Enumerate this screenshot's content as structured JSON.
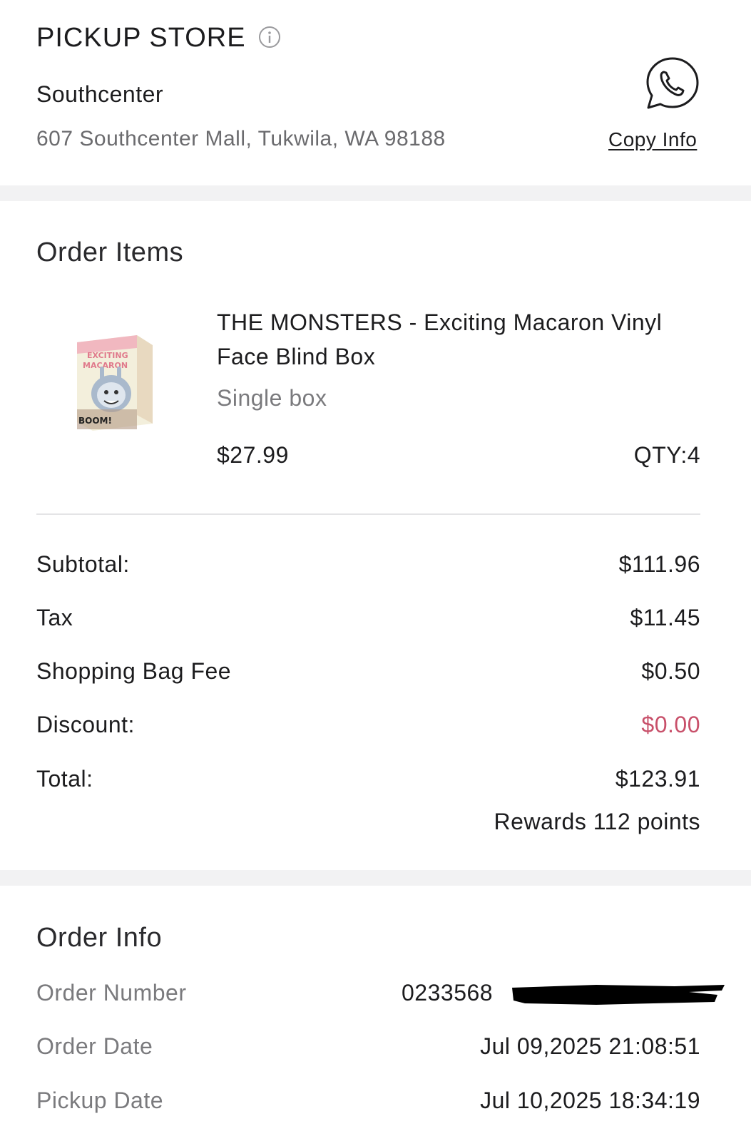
{
  "pickup_store": {
    "heading": "PICKUP STORE",
    "store_name": "Southcenter",
    "address": "607 Southcenter Mall, Tukwila, WA 98188",
    "copy_info_label": "Copy Info",
    "icons": {
      "info": "info-circle-icon",
      "contact": "whatsapp-phone-icon"
    }
  },
  "order_items": {
    "title": "Order Items",
    "items": [
      {
        "name": "THE MONSTERS - Exciting Macaron Vinyl Face Blind Box",
        "variant": "Single box",
        "price": "$27.99",
        "qty": "QTY:4",
        "thumbnail": "product-box-image",
        "thumbnail_text": [
          "EXCITING",
          "MACARON",
          "BOOM!"
        ]
      }
    ],
    "summary": {
      "subtotal_label": "Subtotal:",
      "subtotal_value": "$111.96",
      "tax_label": "Tax",
      "tax_value": "$11.45",
      "bag_fee_label": "Shopping Bag Fee",
      "bag_fee_value": "$0.50",
      "discount_label": "Discount:",
      "discount_value": "$0.00",
      "total_label": "Total:",
      "total_value": "$123.91",
      "rewards": "Rewards 112 points"
    }
  },
  "order_info": {
    "title": "Order Info",
    "order_number_label": "Order Number",
    "order_number_value": "0233568",
    "order_date_label": "Order Date",
    "order_date_value": "Jul 09,2025 21:08:51",
    "pickup_date_label": "Pickup Date",
    "pickup_date_value": "Jul 10,2025 18:34:19"
  },
  "colors": {
    "text": "#1c1c1e",
    "muted": "#7a7a7d",
    "divider": "#f2f2f3",
    "discount": "#c8506a"
  }
}
